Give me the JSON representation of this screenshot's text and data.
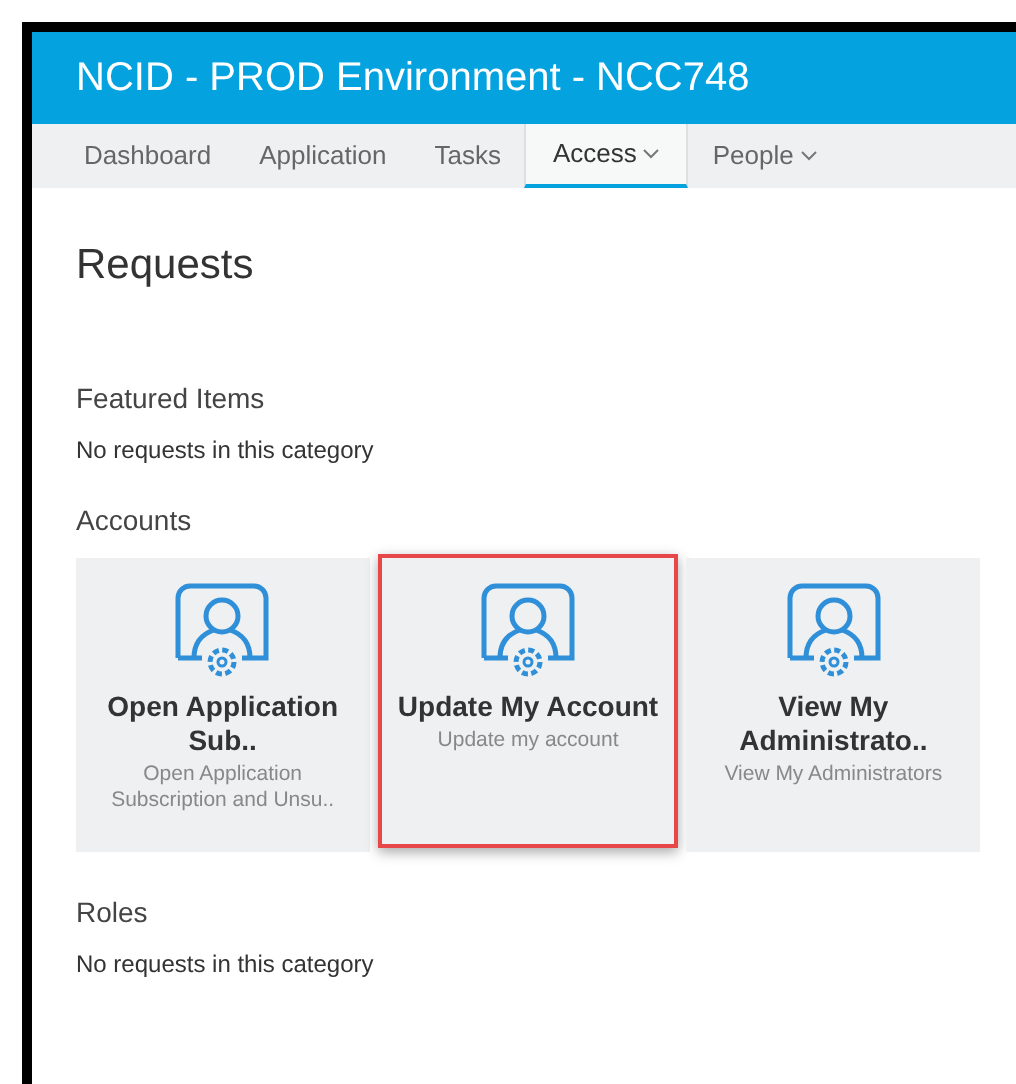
{
  "header": {
    "title": "NCID - PROD Environment - NCC748"
  },
  "nav": [
    {
      "label": "Dashboard",
      "selected": false,
      "dropdown": false
    },
    {
      "label": "Application",
      "selected": false,
      "dropdown": false
    },
    {
      "label": "Tasks",
      "selected": false,
      "dropdown": false
    },
    {
      "label": "Access",
      "selected": true,
      "dropdown": true
    },
    {
      "label": "People",
      "selected": false,
      "dropdown": true
    }
  ],
  "page_title": "Requests",
  "sections": [
    {
      "heading": "Featured Items",
      "empty_text": "No requests in this category"
    },
    {
      "heading": "Accounts",
      "cards": [
        {
          "title": "Open Application Sub..",
          "description": "Open Application Subscription and Unsu..",
          "selected": false
        },
        {
          "title": "Update My Account",
          "description": "Update my account",
          "selected": true
        },
        {
          "title": "View My Administrato..",
          "description": "View My Administrators",
          "selected": false
        }
      ]
    },
    {
      "heading": "Roles",
      "empty_text": "No requests in this category"
    }
  ]
}
